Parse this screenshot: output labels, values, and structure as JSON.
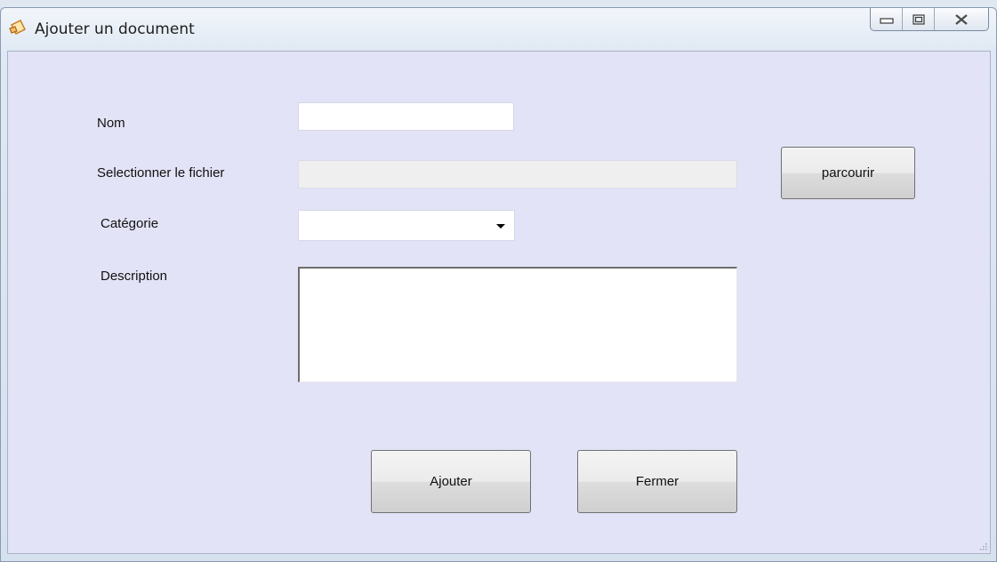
{
  "window": {
    "title": "Ajouter un document",
    "icon": "document-edit-icon",
    "controls": [
      "minimize-icon",
      "maximize-icon",
      "close-icon"
    ]
  },
  "form": {
    "name_label": "Nom",
    "name_value": "",
    "file_label": "Selectionner le fichier",
    "file_value": "",
    "browse_label": "parcourir",
    "category_label": "Catégorie",
    "category_value": "",
    "description_label": "Description",
    "description_value": ""
  },
  "actions": {
    "add_label": "Ajouter",
    "close_label": "Fermer"
  },
  "colors": {
    "client_background": "#e3e3f7",
    "title_bar": "#dfe8f3"
  }
}
